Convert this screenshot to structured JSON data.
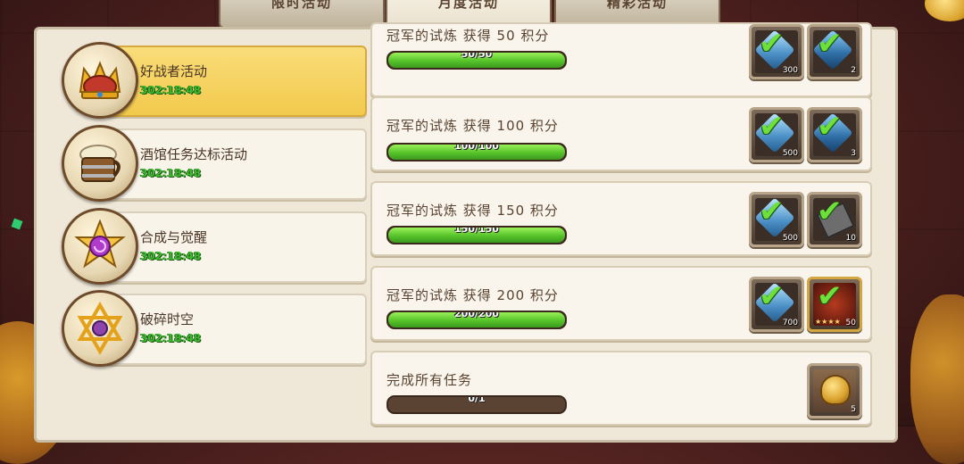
{
  "tabs": [
    {
      "label": "限时活动",
      "active": false
    },
    {
      "label": "月度活动",
      "active": true
    },
    {
      "label": "精彩活动",
      "active": false
    }
  ],
  "sidebar": {
    "items": [
      {
        "title": "好战者活动",
        "timer": "302:18:48",
        "icon": "crown-icon",
        "active": true
      },
      {
        "title": "酒馆任务达标活动",
        "timer": "302:18:48",
        "icon": "beer-mug-icon",
        "active": false
      },
      {
        "title": "合成与觉醒",
        "timer": "302:18:48",
        "icon": "star-emblem-icon",
        "active": false
      },
      {
        "title": "破碎时空",
        "timer": "302:18:48",
        "icon": "hexagram-icon",
        "active": false
      }
    ]
  },
  "tasks": [
    {
      "title": "冠军的试炼 获得  50 积分",
      "progress_text": "50/50",
      "progress": 1.0,
      "rewards": [
        {
          "icon": "blue-gem-icon",
          "count": "300",
          "claimed": true
        },
        {
          "icon": "crystal-shard-icon",
          "count": "2",
          "claimed": true
        }
      ]
    },
    {
      "title": "冠军的试炼 获得  100 积分",
      "progress_text": "100/100",
      "progress": 1.0,
      "rewards": [
        {
          "icon": "blue-gem-icon",
          "count": "500",
          "claimed": true
        },
        {
          "icon": "crystal-shard-icon",
          "count": "3",
          "claimed": true
        }
      ]
    },
    {
      "title": "冠军的试炼 获得  150 积分",
      "progress_text": "150/150",
      "progress": 1.0,
      "rewards": [
        {
          "icon": "blue-gem-icon",
          "count": "500",
          "claimed": true
        },
        {
          "icon": "scroll-icon",
          "count": "10",
          "claimed": true
        }
      ]
    },
    {
      "title": "冠军的试炼 获得  200 积分",
      "progress_text": "200/200",
      "progress": 1.0,
      "rewards": [
        {
          "icon": "blue-gem-icon",
          "count": "700",
          "claimed": true
        },
        {
          "icon": "hero-card-icon",
          "count": "50",
          "claimed": true
        }
      ]
    },
    {
      "title": "完成所有任务",
      "progress_text": "0/1",
      "progress": 0.0,
      "rewards": [
        {
          "icon": "golden-bell-icon",
          "count": "5",
          "claimed": false
        }
      ]
    }
  ],
  "colors": {
    "accent_yellow": "#f2c94c",
    "progress_green": "#56c32a",
    "timer_green": "#3dbb2f"
  }
}
